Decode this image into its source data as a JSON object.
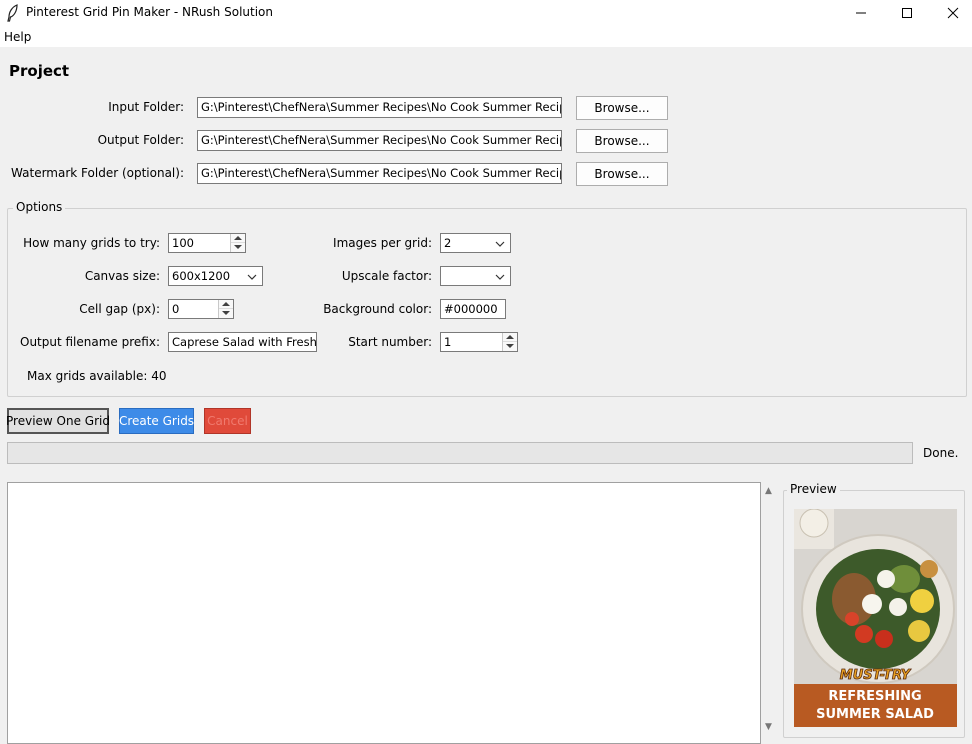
{
  "window": {
    "title": "Pinterest Grid Pin Maker - NRush Solution",
    "icon": "feather-icon"
  },
  "menu": {
    "help": "Help"
  },
  "project": {
    "title": "Project",
    "input_label": "Input Folder:",
    "input_value": "G:\\Pinterest\\ChefNera\\Summer Recipes\\No Cook Summer Recipes\\Caprese Salad with Fresh Mozzarella",
    "output_label": "Output Folder:",
    "output_value": "G:\\Pinterest\\ChefNera\\Summer Recipes\\No Cook Summer Recipes\\Pins",
    "watermark_label": "Watermark Folder (optional):",
    "watermark_value": "G:\\Pinterest\\ChefNera\\Summer Recipes\\No Cook Summer Recipes\\Watermark",
    "browse_label": "Browse..."
  },
  "options": {
    "title": "Options",
    "grids_label": "How many grids to try:",
    "grids_value": "100",
    "canvas_label": "Canvas size:",
    "canvas_value": "600x1200",
    "gap_label": "Cell gap (px):",
    "gap_value": "0",
    "prefix_label": "Output filename prefix:",
    "prefix_value": "Caprese Salad with Fresh M",
    "images_label": "Images per grid:",
    "images_value": "2",
    "upscale_label": "Upscale factor:",
    "upscale_value": "",
    "bg_label": "Background color:",
    "bg_value": "#000000",
    "start_label": "Start number:",
    "start_value": "1",
    "max_grids": "Max grids available: 40"
  },
  "actions": {
    "preview": "Preview One Grid",
    "create": "Create Grids",
    "cancel": "Cancel"
  },
  "progress": {
    "fraction": 0,
    "status": "Done."
  },
  "log": {
    "text": ""
  },
  "preview": {
    "title": "Preview",
    "banner_top": "MUST-TRY",
    "banner_line1": "REFRESHING",
    "banner_line2": "SUMMER SALAD"
  },
  "colors": {
    "create_button": "#3d8be8",
    "cancel_button": "#e04a3a",
    "banner": "#b85a22"
  }
}
